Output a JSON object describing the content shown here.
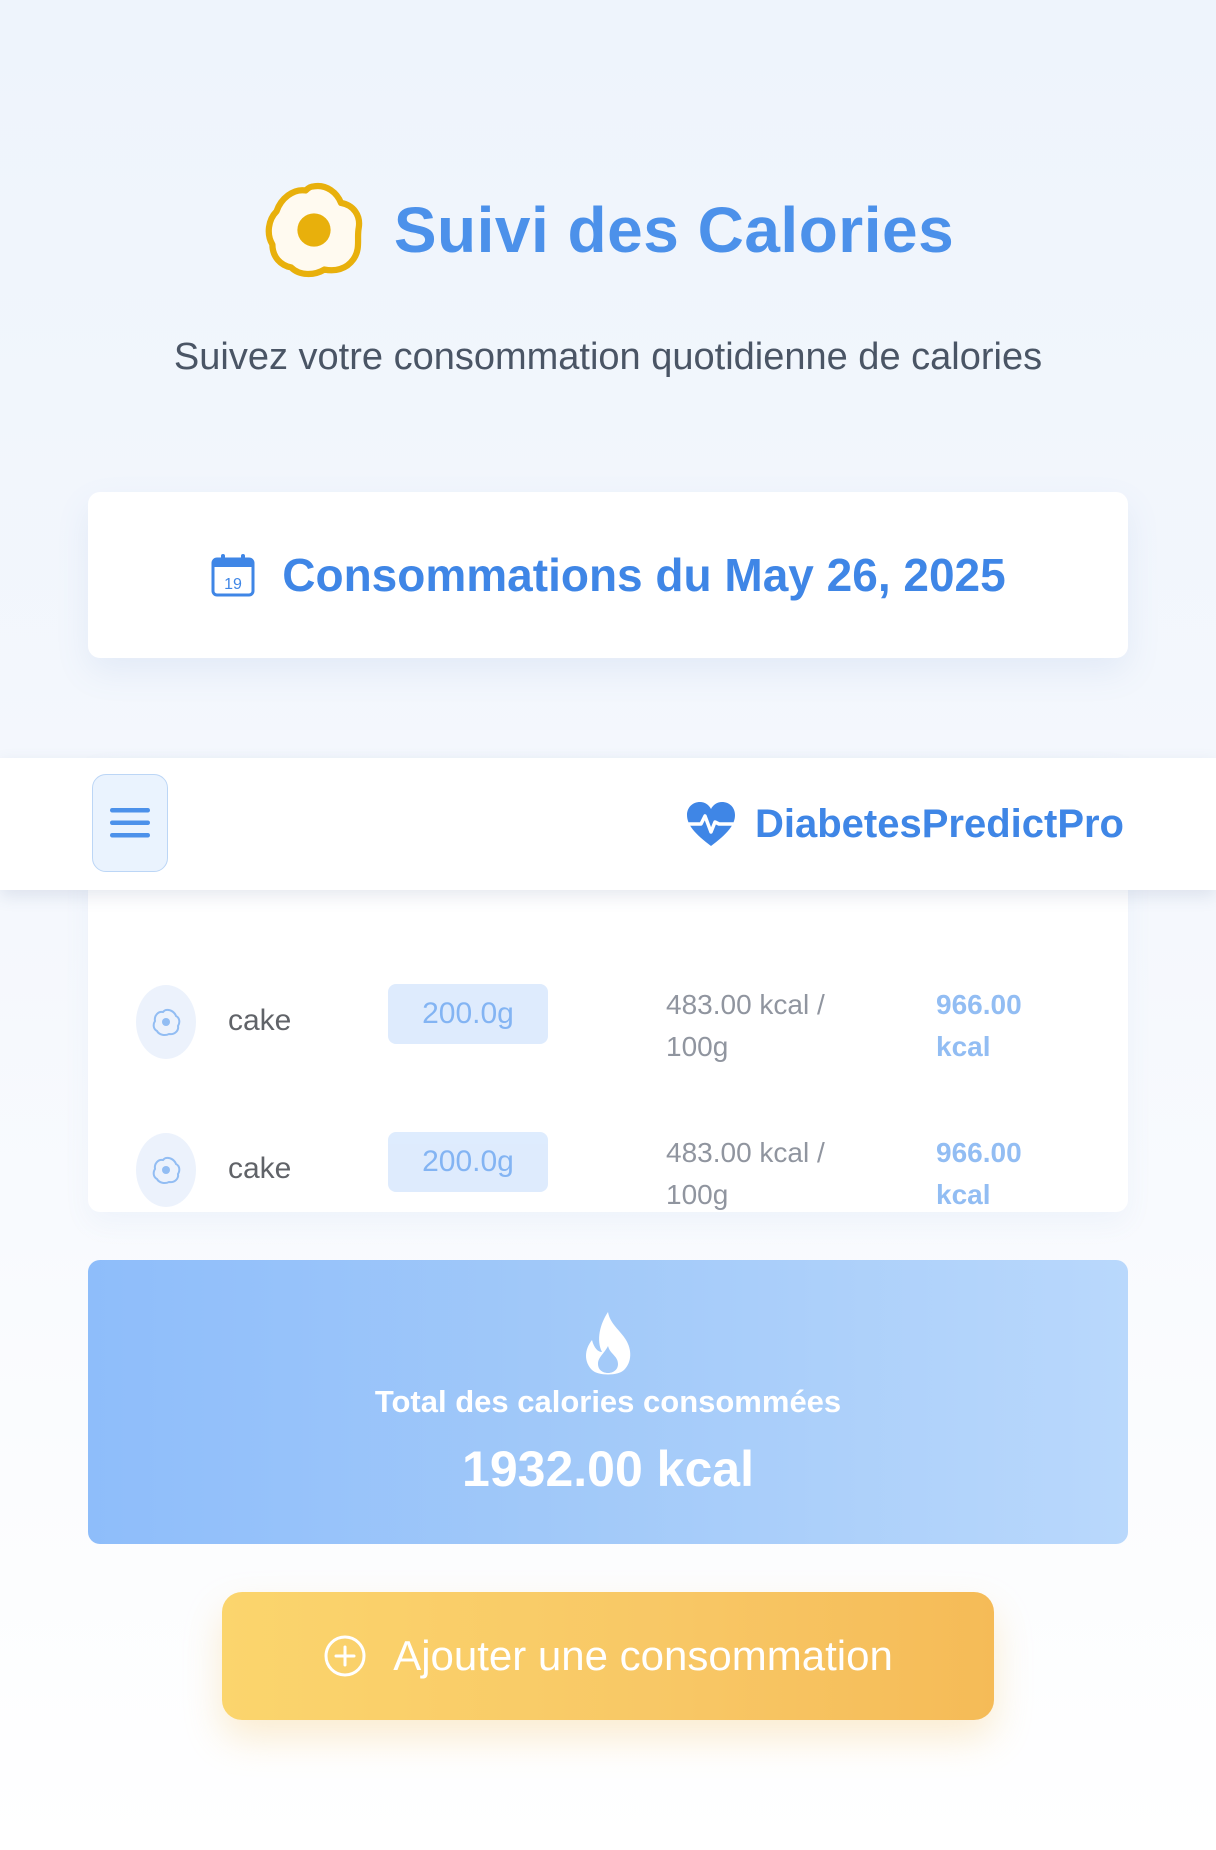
{
  "header": {
    "title": "Suivi des Calories",
    "subtitle": "Suivez votre consommation quotidienne de calories",
    "icon": "fried-egg-icon"
  },
  "date_card": {
    "icon": "calendar-icon",
    "calendar_day": "19",
    "title": "Consommations du May 26, 2025"
  },
  "navbar": {
    "menu_icon": "hamburger-menu-icon",
    "brand_icon": "heart-pulse-icon",
    "brand_name": "DiabetesPredictPro"
  },
  "consumptions": [
    {
      "food": "cake",
      "quantity": "200.0g",
      "per100_value": "483.00 kcal /",
      "per100_unit": "100g",
      "total_value": "966.00",
      "total_unit": "kcal"
    },
    {
      "food": "cake",
      "quantity": "200.0g",
      "per100_value": "483.00 kcal /",
      "per100_unit": "100g",
      "total_value": "966.00",
      "total_unit": "kcal"
    }
  ],
  "total": {
    "icon": "fire-icon",
    "label": "Total des calories consommées",
    "value": "1932.00 kcal"
  },
  "add_button": {
    "icon": "plus-circle-icon",
    "label": "Ajouter une consommation"
  },
  "colors": {
    "primary": "#4c91ea",
    "accent_yellow": "#e8b00c",
    "button_gradient_start": "#fbd56d",
    "button_gradient_end": "#f5bb57",
    "total_gradient_start": "#8ebdfa",
    "total_gradient_end": "#b9d8fc"
  }
}
